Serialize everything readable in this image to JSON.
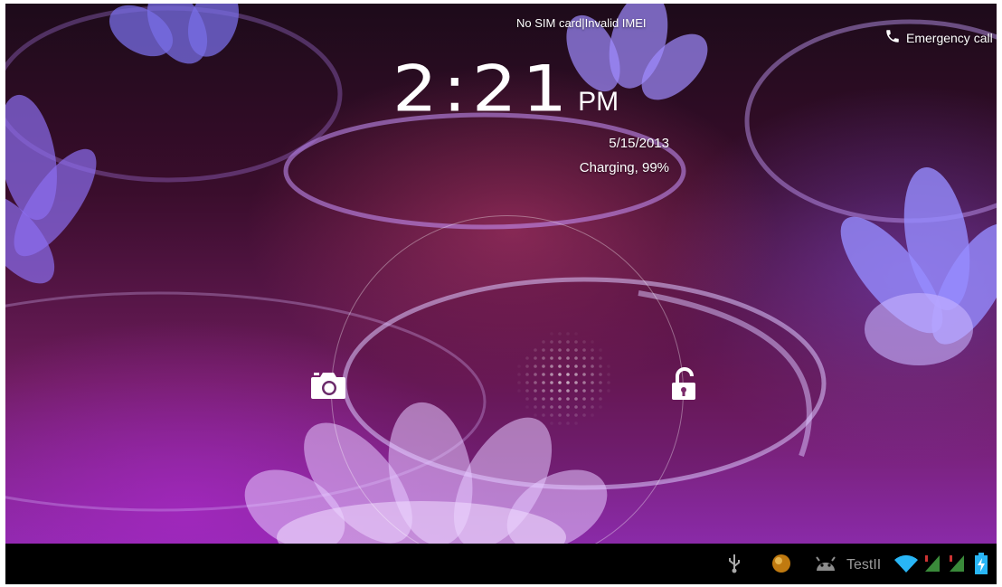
{
  "lockscreen": {
    "sim_status": "No SIM card|Invalid IMEI",
    "emergency_label": "Emergency call",
    "time": "2:21",
    "ampm": "PM",
    "date": "5/15/2013",
    "charging": "Charging, 99%"
  },
  "targets": {
    "left_icon": "camera-icon",
    "right_icon": "unlock-icon",
    "center": "glow-pad-handle"
  },
  "status_bar": {
    "icons": [
      "usb-icon",
      "notification-dot-icon",
      "android-debug-icon",
      "wifi-icon",
      "signal-icon",
      "signal-icon",
      "battery-charging-icon"
    ],
    "label": "TestII",
    "accent_color": "#29b6f6"
  }
}
